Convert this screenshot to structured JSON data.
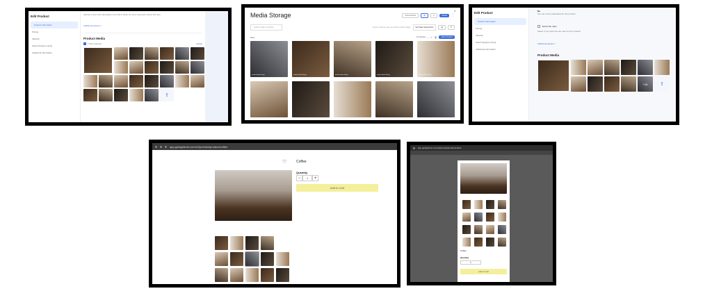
{
  "panel1": {
    "sidebar_title": "Edit Product",
    "nav": [
      "Product information",
      "Pricing",
      "Variants",
      "Search Engine Listing",
      "Additional Information"
    ],
    "helper_text": "Identify a very short description and call to action for your customers about this item",
    "additional_options": "Additional options >",
    "product_media_title": "Product Media",
    "selected_label": "7 files selected",
    "delete_label": "Delete",
    "upload_icon": "upload-icon"
  },
  "panel2": {
    "title": "Media Storage",
    "close": "×",
    "btn_connect": "Connect Drive",
    "btn_upload": "Upload",
    "search_placeholder": "Search media or products",
    "hint": "Search media by name or products which images",
    "sort": "Sort Date: Newest First",
    "all_label": "Files",
    "selected_label": "10 selected",
    "add_selected": "Add to Product",
    "tiles": [
      "product-photo-01.jpg",
      "product-photo-02.jpg",
      "product-photo-03.jpg",
      "product-photo-04.jpg",
      "product-photo-05.jpg",
      "",
      "",
      "",
      "",
      ""
    ]
  },
  "panel3": {
    "sidebar_title": "Edit Product",
    "nav": [
      "Product information",
      "Pricing",
      "Variants",
      "Search Engine Listing",
      "Additional Information"
    ],
    "no_label": "No",
    "helper_text": "Tax can not be calculated for this product",
    "tax_label": "Enroll Tax rules",
    "tax_helper": "Select if you want use tax rules for this product",
    "additional_options": "Additional options >",
    "product_media_title": "Product Media",
    "more_count": "+18"
  },
  "panel4": {
    "url": "app.gohighlevel.com/v2/preview/product/coffee",
    "product_title": "Coffee",
    "quantity_label": "Quantity",
    "quantity_value": "1",
    "minus": "−",
    "plus": "+",
    "add_to_cart": "Add to Cart"
  },
  "panel5": {
    "url": "app.gohighlevel.com/v2/preview/product/coffee",
    "product_title": "Coffee",
    "quantity_label": "Quantity",
    "quantity_value": "1",
    "add_to_cart": "Add to Cart"
  }
}
